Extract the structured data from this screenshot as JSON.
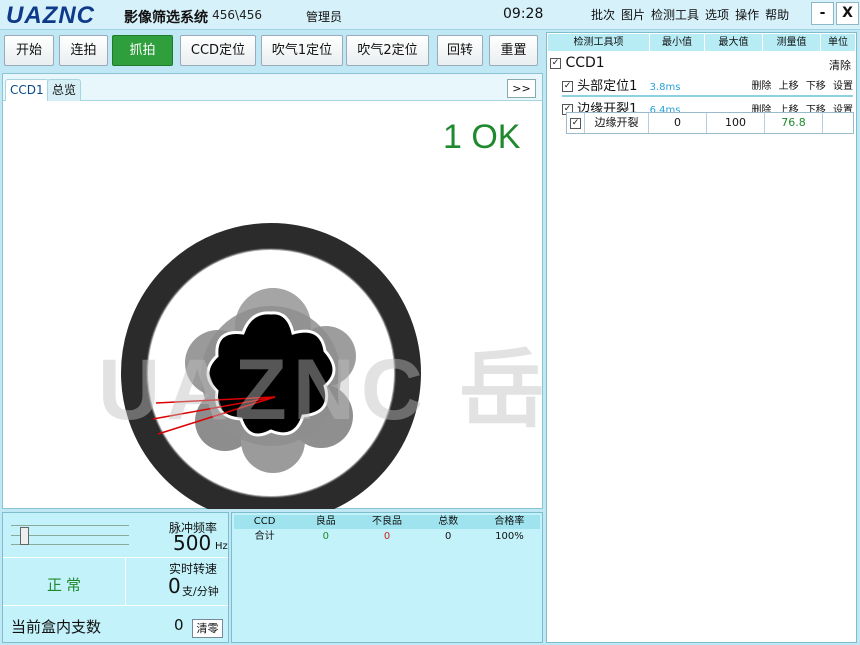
{
  "title": {
    "logo": "UAZNC",
    "app_name": "影像筛选系统",
    "version": "- 456\\456",
    "user": "管理员",
    "time": "09:28",
    "menu": [
      "批次",
      "图片",
      "检测工具",
      "选项",
      "操作",
      "帮助"
    ],
    "minimize": "-",
    "close": "X"
  },
  "toolbar": {
    "start": "开始",
    "burst": "连拍",
    "capture": "抓拍",
    "ccd_pos": "CCD定位",
    "blow1": "吹气1定位",
    "blow2": "吹气2定位",
    "rotate": "回转",
    "reset": "重置"
  },
  "view": {
    "tabs": [
      "CCD1",
      "总览"
    ],
    "more": ">>",
    "result": "1 OK",
    "watermark": "UAZNC 岳展®"
  },
  "control": {
    "pulse_label": "脉冲频率",
    "pulse_value": "500",
    "pulse_unit": "Hz",
    "slider_level": 0.08,
    "status": "正常",
    "speed_label": "实时转速",
    "speed_value": "0",
    "speed_unit": "支/分钟",
    "count_label": "当前盒内支数",
    "count_value": "0",
    "clear": "清零"
  },
  "stats": {
    "headers": [
      "CCD",
      "良品",
      "不良品",
      "总数",
      "合格率"
    ],
    "row": [
      "合计",
      "0",
      "0",
      "0",
      "100%"
    ]
  },
  "tools": {
    "headers": [
      "检测工具项",
      "最小值",
      "最大值",
      "测量值",
      "单位"
    ],
    "ccd": "CCD1",
    "clear": "清除",
    "items": [
      {
        "name": "头部定位1",
        "time": "3.8ms",
        "ops": [
          "删除",
          "上移",
          "下移",
          "设置"
        ]
      },
      {
        "name": "边缘开裂1",
        "time": "6.4ms",
        "ops": [
          "删除",
          "上移",
          "下移",
          "设置"
        ]
      }
    ],
    "sub": {
      "name": "边缘开裂",
      "min": "0",
      "max": "100",
      "value": "76.8"
    }
  },
  "colors": {
    "ok": "#1f8a2d",
    "accent": "#bfe8f4",
    "ms": "#28a0d8"
  }
}
